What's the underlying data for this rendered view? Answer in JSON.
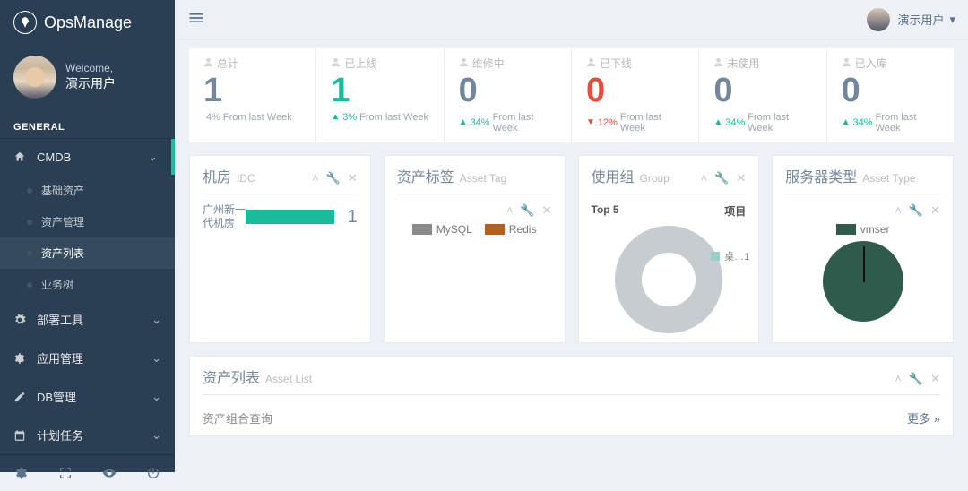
{
  "brand": {
    "title": "OpsManage"
  },
  "profile": {
    "welcome_label": "Welcome,",
    "user_name": "演示用户"
  },
  "menu": {
    "section_title": "GENERAL",
    "items": [
      {
        "label": "CMDB",
        "icon": "home",
        "expanded": true,
        "children": [
          {
            "label": "基础资产"
          },
          {
            "label": "资产管理"
          },
          {
            "label": "资产列表",
            "active": true
          },
          {
            "label": "业务树"
          }
        ]
      },
      {
        "label": "部署工具",
        "icon": "gear"
      },
      {
        "label": "应用管理",
        "icon": "gear"
      },
      {
        "label": "DB管理",
        "icon": "edit"
      },
      {
        "label": "计划任务",
        "icon": "calendar"
      }
    ]
  },
  "topbar": {
    "user_name": "演示用户"
  },
  "stats": [
    {
      "title": "总计",
      "count": "1",
      "color": "",
      "trend": "none",
      "pct": "4%",
      "suffix": "From last Week"
    },
    {
      "title": "已上线",
      "count": "1",
      "color": "green",
      "trend": "up",
      "pct": "3%",
      "suffix": "From last Week"
    },
    {
      "title": "维修中",
      "count": "0",
      "color": "",
      "trend": "up",
      "pct": "34%",
      "suffix": "From last Week"
    },
    {
      "title": "已下线",
      "count": "0",
      "color": "red",
      "trend": "down",
      "pct": "12%",
      "suffix": "From last Week"
    },
    {
      "title": "未使用",
      "count": "0",
      "color": "",
      "trend": "up",
      "pct": "34%",
      "suffix": "From last Week"
    },
    {
      "title": "已入库",
      "count": "0",
      "color": "",
      "trend": "up",
      "pct": "34%",
      "suffix": "From last Week"
    }
  ],
  "panels": {
    "idc": {
      "title": "机房",
      "sub": "IDC",
      "rows": [
        {
          "name": "广州新一代机房",
          "value": "1"
        }
      ]
    },
    "tags": {
      "title": "资产标签",
      "sub": "Asset Tag",
      "legend": [
        {
          "label": "MySQL",
          "color": "#8a8a8a"
        },
        {
          "label": "Redis",
          "color": "#b45f1e"
        }
      ]
    },
    "group": {
      "title": "使用组",
      "sub": "Group",
      "top_label": "Top 5",
      "col_label": "项目",
      "legend_item": "桌…1"
    },
    "server_type": {
      "title": "服务器类型",
      "sub": "Asset Type",
      "legend": [
        {
          "label": "vmser",
          "color": "#2f5b4c"
        }
      ]
    },
    "asset_list": {
      "title": "资产列表",
      "sub": "Asset List",
      "combo_label": "资产组合查询",
      "more_label": "更多"
    }
  }
}
